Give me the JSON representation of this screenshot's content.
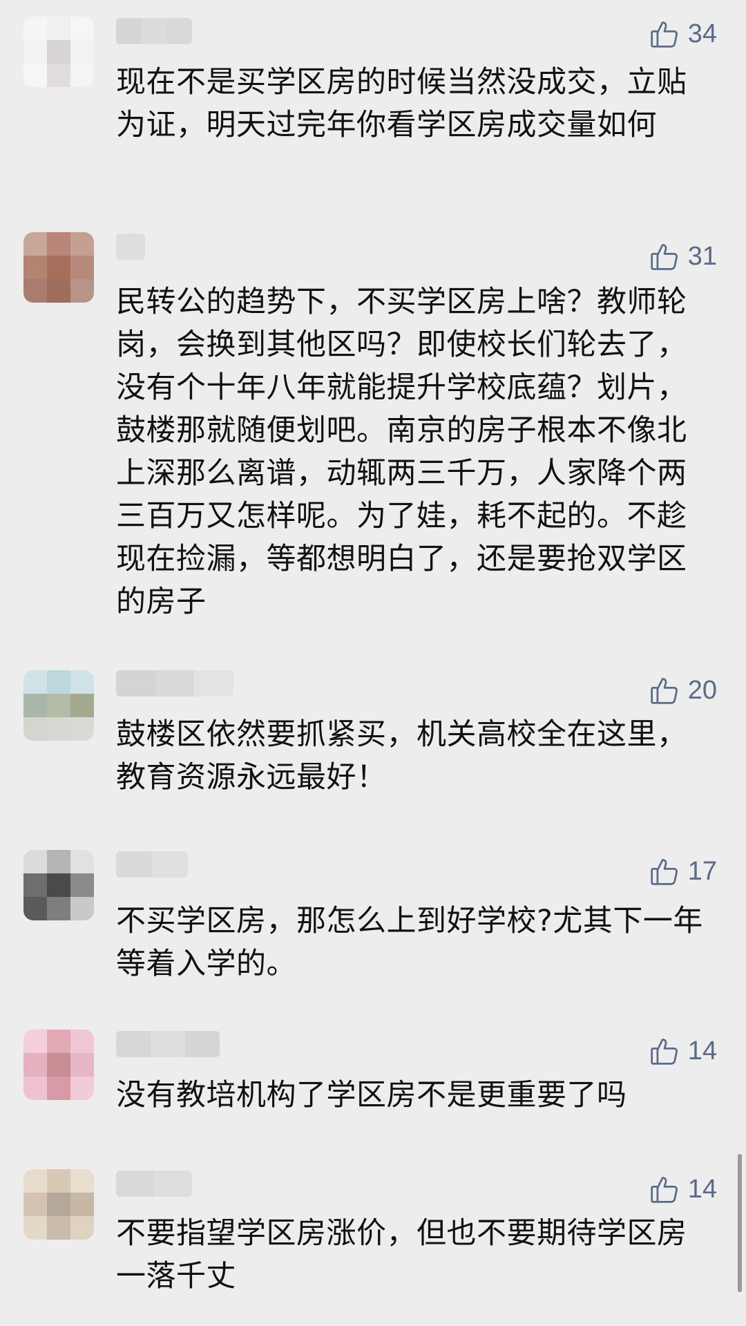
{
  "comments": [
    {
      "likes": "34",
      "text": "现在不是买学区房的时候当然没成交，立贴为证，明天过完年你看学区房成交量如何"
    },
    {
      "likes": "31",
      "text": "民转公的趋势下，不买学区房上啥？教师轮岗，会换到其他区吗？即使校长们轮去了，没有个十年八年就能提升学校底蕴？划片，鼓楼那就随便划吧。南京的房子根本不像北上深那么离谱，动辄两三千万，人家降个两三百万又怎样呢。为了娃，耗不起的。不趁现在捡漏，等都想明白了，还是要抢双学区的房子"
    },
    {
      "likes": "20",
      "text": "鼓楼区依然要抓紧买，机关高校全在这里，教育资源永远最好！"
    },
    {
      "likes": "17",
      "text": "不买学区房，那怎么上到好学校?尤其下一年等着入学的。"
    },
    {
      "likes": "14",
      "text": "没有教培机构了学区房不是更重要了吗"
    },
    {
      "likes": "14",
      "text": "不要指望学区房涨价，但也不要期待学区房一落千丈"
    }
  ],
  "icons": {
    "like": "thumbs-up-outline-icon"
  },
  "colors": {
    "background": "#ededed",
    "text": "#111111",
    "like": "#5b6b86"
  }
}
